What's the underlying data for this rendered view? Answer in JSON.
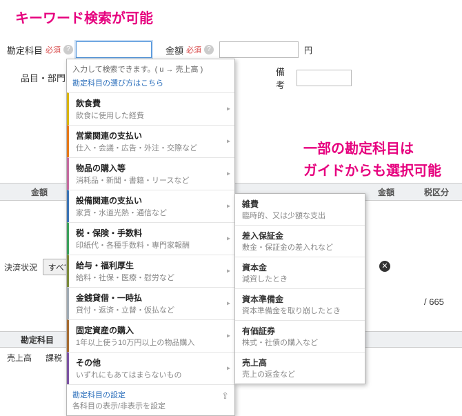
{
  "annotations": {
    "a1": "キーワード検索が可能",
    "a2_line1": "一部の勘定科目は",
    "a2_line2": "ガイドからも選択可能"
  },
  "form": {
    "account_label": "勘定科目",
    "required": "必須",
    "amount_label": "金額",
    "yen": "円",
    "row2_label": "品目・部門",
    "memo_label": "備考"
  },
  "dropdown": {
    "header_text": "入力して検索できます。( u → 売上高 )",
    "how_link": "勘定科目の選び方はこちら",
    "items": [
      {
        "title": "飲食費",
        "sub": "飲食に使用した経費",
        "color": "c-yellow"
      },
      {
        "title": "営業関連の支払い",
        "sub": "仕入・会議・広告・外注・交際など",
        "color": "c-orange"
      },
      {
        "title": "物品の購入等",
        "sub": "消耗品・新聞・書籍・リースなど",
        "color": "c-pink"
      },
      {
        "title": "設備関連の支払い",
        "sub": "家賃・水道光熱・通信など",
        "color": "c-blue"
      },
      {
        "title": "税・保険・手数料",
        "sub": "印紙代・各種手数料・専門家報酬",
        "color": "c-green"
      },
      {
        "title": "給与・福利厚生",
        "sub": "給料・社保・医療・慰労など",
        "color": "c-olive"
      },
      {
        "title": "金銭貸借・一時払",
        "sub": "貸付・返済・立替・仮払など",
        "color": "c-gray"
      },
      {
        "title": "固定資産の購入",
        "sub": "1年以上使う10万円以上の物品購入",
        "color": "c-brown"
      },
      {
        "title": "その他",
        "sub": "いずれにもあてはまらないもの",
        "color": "c-purple"
      }
    ],
    "footer_link": "勘定科目の設定",
    "footer_sub": "各科目の表示/非表示を設定"
  },
  "submenu": {
    "items": [
      {
        "title": "雑費",
        "sub": "臨時的、又は少額な支出"
      },
      {
        "title": "差入保証金",
        "sub": "敷金・保証金の差入れなど"
      },
      {
        "title": "資本金",
        "sub": "減資したとき"
      },
      {
        "title": "資本準備金",
        "sub": "資本準備金を取り崩したとき"
      },
      {
        "title": "有価証券",
        "sub": "株式・社債の購入など"
      },
      {
        "title": "売上高",
        "sub": "売上の返金など"
      }
    ]
  },
  "bg": {
    "col_amount": "金額",
    "col_amount2": "金額",
    "col_tax": "税区分",
    "settle_label": "決済状況",
    "all": "すべて",
    "count": "/ 665",
    "footer_col": "勘定科目",
    "bottom1": "売上高",
    "bottom2": "課税"
  }
}
